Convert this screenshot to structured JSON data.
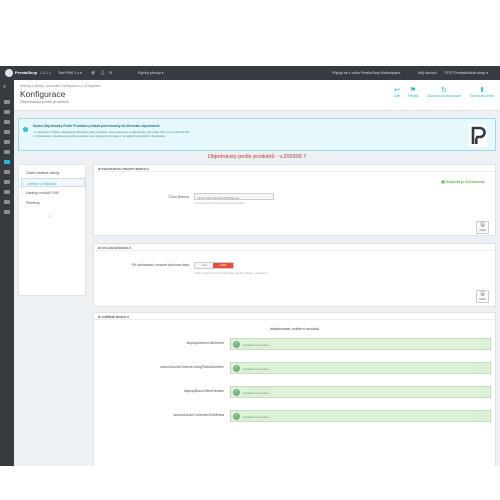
{
  "topbar": {
    "brand_main": "PrestaShop",
    "brand_accent": "Shop",
    "version": "1.6.1.x",
    "shop_selector": "Test PMS 1.x ▾",
    "quick_access": "Rychlý přístup ▾",
    "show_store": "Připojit se k celku PrestaShop Marketplace",
    "my_store": "Můj obchod",
    "user": "TEST PrestaModule.shop ▾"
  },
  "breadcrumb": "Moduly a Služby  /  pro lokální Konfigurace  /  ▸ Konfigurace",
  "page": {
    "title": "Konfigurace",
    "subtitle": "Objednávky podle produktů"
  },
  "toolbar": [
    {
      "label": "Zpět",
      "icon": "↩"
    },
    {
      "label": "Překlad",
      "icon": "⚑"
    },
    {
      "label": "Zkontrolovat aktualizace",
      "icon": "↻"
    },
    {
      "label": "Spravovat vzhled",
      "icon": "⬆"
    }
  ],
  "info": {
    "line1": "Modul Objednávky Podle Produktu přidává pole/moduly do filtrování objednávek.",
    "line2": "• V přehledu můžete objednávky filtrovat podle produktu nebo kategorie a objednávky až podle účtů přes pokročilý filtr.",
    "line3": "• Vyhledávání objednávek podle produktu nebo kategorie funguje i na dalších stránkách objednávky.",
    "icon": "info-icon"
  },
  "module_title": "Objednávky podle produktů",
  "module_version": " - v.200309.7",
  "left_menu": [
    {
      "label": "Časté kladené otázky",
      "active": false
    },
    {
      "label": "Licence a instalace",
      "active": true
    },
    {
      "label": "Katalog modulů PMS",
      "active": false
    },
    {
      "label": "Přehledy",
      "active": false
    }
  ],
  "license_panel": {
    "heading": "⚙ REGISTRACE TOHOTO MODULU",
    "label": "Číslo licence",
    "value": "TEST-ONLY-NO-FILTRADE-xxx",
    "help": "Použijte licenci pro registraci tohoto modulu.",
    "status": "Produkt je licencován",
    "save": "Uložit"
  },
  "control_panel": {
    "heading": "⚙ OVLÁDÁNÍ MODULU",
    "label": "Při odinstalaci zmazat všechna data",
    "off": "NE",
    "on": "ANO",
    "help": "Zvolte si zda chcete všechna data, všechny tabulky a nastavení.",
    "save": "Uložit"
  },
  "check_panel": {
    "heading": "⚙ OVĚŘENÍ MODULU",
    "title": "Instalované ověření modulu",
    "hooks": [
      {
        "name": "displayAdminListBefore",
        "status": "Úspěšně provedeno"
      },
      {
        "name": "actionAdminOrdersListingFieldsModifier",
        "status": "Úspěšně provedeno"
      },
      {
        "name": "displayBackOfficeHeader",
        "status": "Úspěšně provedeno"
      },
      {
        "name": "actionAdminControllerSetMedia",
        "status": "Úspěšně provedeno"
      }
    ]
  }
}
